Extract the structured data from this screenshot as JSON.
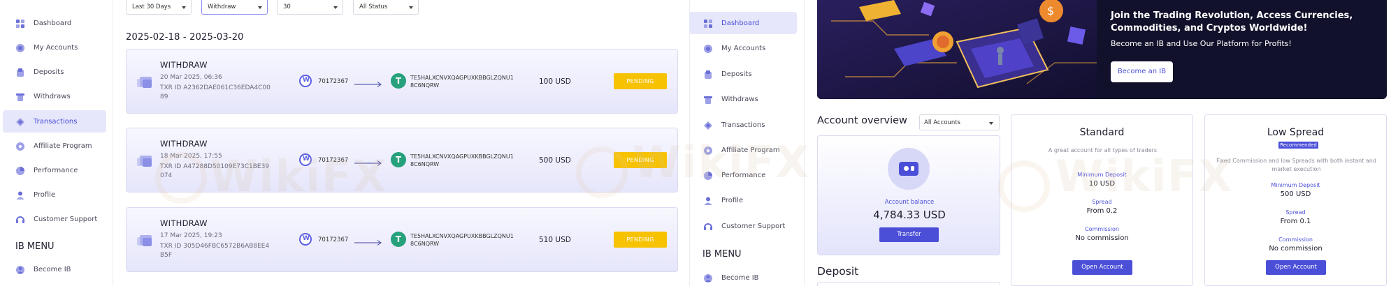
{
  "sidebar": {
    "items": [
      {
        "label": "Dashboard",
        "icon": "dashboard-icon"
      },
      {
        "label": "My Accounts",
        "icon": "accounts-icon"
      },
      {
        "label": "Deposits",
        "icon": "deposits-icon"
      },
      {
        "label": "Withdraws",
        "icon": "withdraws-icon"
      },
      {
        "label": "Transactions",
        "icon": "transactions-icon"
      },
      {
        "label": "Affiliate Program",
        "icon": "affiliate-icon"
      },
      {
        "label": "Performance",
        "icon": "performance-icon"
      },
      {
        "label": "Profile",
        "icon": "profile-icon"
      },
      {
        "label": "Customer Support",
        "icon": "support-icon"
      }
    ],
    "ib_title": "IB MENU",
    "ib_items": [
      {
        "label": "Become IB",
        "icon": "become-ib-icon"
      }
    ]
  },
  "filters": {
    "period": "Last 30 Days",
    "type": "Withdraw",
    "page_size": "30",
    "status": "All Status"
  },
  "date_range": "2025-02-18 - 2025-03-20",
  "transactions": [
    {
      "type": "WITHDRAW",
      "date": "20 Mar 2025, 06:36",
      "txr_id": "TXR ID A2362DAE061C36EDA4C0089",
      "from": "70172367",
      "to": "TE5HALXCNVXQAGPUXKBBGLZQNU18C6NQRW",
      "amount": "100 USD",
      "status": "PENDING"
    },
    {
      "type": "WITHDRAW",
      "date": "18 Mar 2025, 17:55",
      "txr_id": "TXR ID A47288D50109E73C1BE39074",
      "from": "70172367",
      "to": "TE5HALXCNVXQAGPUXKBBGLZQNU18C6NQRW",
      "amount": "500 USD",
      "status": "PENDING"
    },
    {
      "type": "WITHDRAW",
      "date": "17 Mar 2025, 19:23",
      "txr_id": "TXR ID 305D46FBC6572B6AB8EE4B5F",
      "from": "70172367",
      "to": "TE5HALXCNVXQAGPUXKBBGLZQNU18C6NQRW",
      "amount": "510 USD",
      "status": "PENDING"
    }
  ],
  "banner": {
    "title": "Join the Trading Revolution, Access Currencies, Commodities, and Cryptos Worldwide!",
    "subtitle": "Become an IB and Use Our Platform for Profits!",
    "button": "Become an IB"
  },
  "overview": {
    "title": "Account overview",
    "select": "All Accounts",
    "balance_label": "Account balance",
    "balance_value": "4,784.33 USD",
    "transfer_button": "Transfer",
    "deposit_title": "Deposit"
  },
  "account_types": [
    {
      "name": "Standard",
      "badge": "",
      "description": "A great account for all types of traders",
      "min_deposit_label": "Minimum Deposit",
      "min_deposit": "10 USD",
      "spread_label": "Spread",
      "spread": "From 0.2",
      "commission_label": "Commission",
      "commission": "No commission",
      "button": "Open Account"
    },
    {
      "name": "Low Spread",
      "badge": "Recommended",
      "description": "Fixed Commission and low Spreads with both instant and market execution",
      "min_deposit_label": "Minimum Deposit",
      "min_deposit": "500 USD",
      "spread_label": "Spread",
      "spread": "From 0.1",
      "commission_label": "Commission",
      "commission": "No commission",
      "button": "Open Account"
    }
  ],
  "watermark": "WikiFX",
  "colors": {
    "accent": "#4b4fd8",
    "pending": "#f7c200",
    "usdt": "#26a17b",
    "banner_bg": "#12112b"
  }
}
